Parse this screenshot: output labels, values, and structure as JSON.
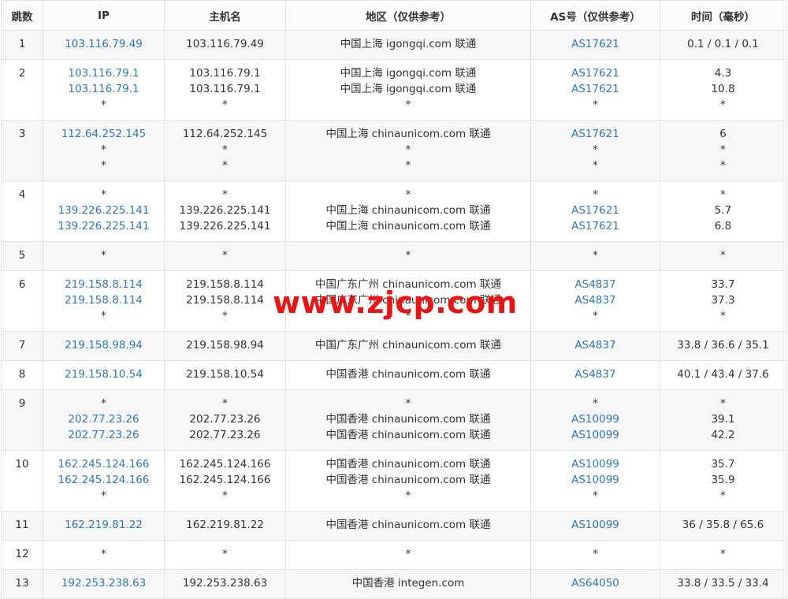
{
  "headers": [
    "跳数",
    "IP",
    "主机名",
    "地区（仅供参考）",
    "AS号（仅供参考）",
    "时间（毫秒）"
  ],
  "rows": [
    {
      "hop": "1",
      "ip": [
        "103.116.79.49"
      ],
      "host": [
        "103.116.79.49"
      ],
      "region": [
        "中国上海 igongqi.com 联通"
      ],
      "as": [
        "AS17621"
      ],
      "time": [
        "0.1 / 0.1 / 0.1"
      ]
    },
    {
      "hop": "2",
      "ip": [
        "103.116.79.1",
        "103.116.79.1",
        "*"
      ],
      "host": [
        "103.116.79.1",
        "103.116.79.1",
        "*"
      ],
      "region": [
        "中国上海 igongqi.com 联通",
        "中国上海 igongqi.com 联通",
        "*"
      ],
      "as": [
        "AS17621",
        "AS17621",
        "*"
      ],
      "time": [
        "4.3",
        "10.8",
        "*"
      ]
    },
    {
      "hop": "3",
      "ip": [
        "112.64.252.145",
        "*",
        "*"
      ],
      "host": [
        "112.64.252.145",
        "*",
        "*"
      ],
      "region": [
        "中国上海 chinaunicom.com 联通",
        "*",
        "*"
      ],
      "as": [
        "AS17621",
        "*",
        "*"
      ],
      "time": [
        "6",
        "*",
        "*"
      ]
    },
    {
      "hop": "4",
      "ip": [
        "*",
        "139.226.225.141",
        "139.226.225.141"
      ],
      "host": [
        "*",
        "139.226.225.141",
        "139.226.225.141"
      ],
      "region": [
        "*",
        "中国上海 chinaunicom.com 联通",
        "中国上海 chinaunicom.com 联通"
      ],
      "as": [
        "*",
        "AS17621",
        "AS17621"
      ],
      "time": [
        "*",
        "5.7",
        "6.8"
      ]
    },
    {
      "hop": "5",
      "ip": [
        "*"
      ],
      "host": [
        "*"
      ],
      "region": [
        "*"
      ],
      "as": [
        "*"
      ],
      "time": [
        "*"
      ]
    },
    {
      "hop": "6",
      "ip": [
        "219.158.8.114",
        "219.158.8.114",
        "*"
      ],
      "host": [
        "219.158.8.114",
        "219.158.8.114",
        "*"
      ],
      "region": [
        "中国广东广州 chinaunicom.com 联通",
        "中国广东广州 chinaunicom.com 联通",
        "*"
      ],
      "as": [
        "AS4837",
        "AS4837",
        "*"
      ],
      "time": [
        "33.7",
        "37.3",
        "*"
      ]
    },
    {
      "hop": "7",
      "ip": [
        "219.158.98.94"
      ],
      "host": [
        "219.158.98.94"
      ],
      "region": [
        "中国广东广州 chinaunicom.com 联通"
      ],
      "as": [
        "AS4837"
      ],
      "time": [
        "33.8 / 36.6 / 35.1"
      ]
    },
    {
      "hop": "8",
      "ip": [
        "219.158.10.54"
      ],
      "host": [
        "219.158.10.54"
      ],
      "region": [
        "中国香港 chinaunicom.com 联通"
      ],
      "as": [
        "AS4837"
      ],
      "time": [
        "40.1 / 43.4 / 37.6"
      ]
    },
    {
      "hop": "9",
      "ip": [
        "*",
        "202.77.23.26",
        "202.77.23.26"
      ],
      "host": [
        "*",
        "202.77.23.26",
        "202.77.23.26"
      ],
      "region": [
        "*",
        "中国香港 chinaunicom.com 联通",
        "中国香港 chinaunicom.com 联通"
      ],
      "as": [
        "*",
        "AS10099",
        "AS10099"
      ],
      "time": [
        "*",
        "39.1",
        "42.2"
      ]
    },
    {
      "hop": "10",
      "ip": [
        "162.245.124.166",
        "162.245.124.166",
        "*"
      ],
      "host": [
        "162.245.124.166",
        "162.245.124.166",
        "*"
      ],
      "region": [
        "中国香港 chinaunicom.com 联通",
        "中国香港 chinaunicom.com 联通",
        "*"
      ],
      "as": [
        "AS10099",
        "AS10099",
        "*"
      ],
      "time": [
        "35.7",
        "35.9",
        "*"
      ]
    },
    {
      "hop": "11",
      "ip": [
        "162.219.81.22"
      ],
      "host": [
        "162.219.81.22"
      ],
      "region": [
        "中国香港 chinaunicom.com 联通"
      ],
      "as": [
        "AS10099"
      ],
      "time": [
        "36 / 35.8 / 65.6"
      ]
    },
    {
      "hop": "12",
      "ip": [
        "*"
      ],
      "host": [
        "*"
      ],
      "region": [
        "*"
      ],
      "as": [
        "*"
      ],
      "time": [
        "*"
      ]
    },
    {
      "hop": "13",
      "ip": [
        "192.253.238.63"
      ],
      "host": [
        "192.253.238.63"
      ],
      "region": [
        "中国香港 integen.com"
      ],
      "as": [
        "AS64050"
      ],
      "time": [
        "33.8 / 33.5 / 33.4"
      ]
    }
  ],
  "watermark": "www.zjcp.com"
}
